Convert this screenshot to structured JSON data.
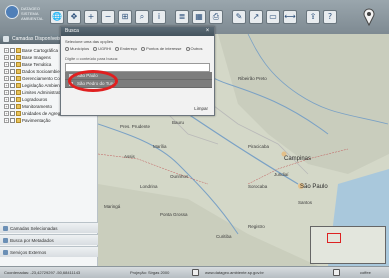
{
  "header": {
    "logo_text": "DATAGEO SISTEMA AMBIENTAL",
    "toolbar": [
      {
        "icon": "globe-icon",
        "glyph": "🌐"
      },
      {
        "icon": "pan-icon",
        "glyph": "✥"
      },
      {
        "icon": "zoom-in-icon",
        "glyph": "+"
      },
      {
        "icon": "zoom-out-icon",
        "glyph": "−"
      },
      {
        "icon": "zoom-box-icon",
        "glyph": "⊞"
      },
      {
        "icon": "search-icon",
        "glyph": "⌕"
      },
      {
        "icon": "info-icon",
        "glyph": "i"
      },
      {
        "icon": "layers-icon",
        "glyph": "≣"
      },
      {
        "icon": "table-icon",
        "glyph": "▦"
      },
      {
        "icon": "print-icon",
        "glyph": "⎙"
      },
      {
        "icon": "draw-icon",
        "glyph": "✎"
      },
      {
        "icon": "arrow-icon",
        "glyph": "↗"
      },
      {
        "icon": "shape-icon",
        "glyph": "▭"
      },
      {
        "icon": "measure-icon",
        "glyph": "⟷"
      },
      {
        "icon": "export-icon",
        "glyph": "⇪"
      },
      {
        "icon": "help-icon",
        "glyph": "?"
      }
    ]
  },
  "sidebar": {
    "title": "Camadas Disponíveis",
    "items": [
      {
        "label": "Base Cartográfica"
      },
      {
        "label": "Base Imagens"
      },
      {
        "label": "Base Temática"
      },
      {
        "label": "Dados Socioambientais"
      },
      {
        "label": "Gerenciamento Costeiro"
      },
      {
        "label": "Legislação Ambiental"
      },
      {
        "label": "Limites Administrativos"
      },
      {
        "label": "Logradouros"
      },
      {
        "label": "Monitoramento"
      },
      {
        "label": "Unidades de Agregação e Análise"
      },
      {
        "label": "Pavimentação"
      }
    ],
    "accordion": [
      {
        "label": "Camadas Selecionadas"
      },
      {
        "label": "Busca por Metadados"
      },
      {
        "label": "Serviços Externos"
      }
    ]
  },
  "dialog": {
    "title": "Busca",
    "instruction": "Selecione uma das opções",
    "options": [
      {
        "label": "Municípios"
      },
      {
        "label": "UGRHI"
      },
      {
        "label": "Endereço"
      },
      {
        "label": "Pontos de interesse"
      },
      {
        "label": "Outros"
      }
    ],
    "search_label": "Digite o conteúdo para busca:",
    "search_value": "",
    "results": [
      {
        "label": "São Paulo"
      },
      {
        "label": "São Pedro do Turvo"
      }
    ],
    "footer": "Limpar"
  },
  "map": {
    "cities": [
      {
        "name": "Pres. Prudente",
        "big": false
      },
      {
        "name": "Marília",
        "big": false
      },
      {
        "name": "Bauru",
        "big": false
      },
      {
        "name": "Ourinhos",
        "big": false
      },
      {
        "name": "Assis",
        "big": false
      },
      {
        "name": "Londrina",
        "big": false
      },
      {
        "name": "Maringá",
        "big": false
      },
      {
        "name": "Campinas",
        "big": true
      },
      {
        "name": "São Paulo",
        "big": true
      },
      {
        "name": "Piracicaba",
        "big": false
      },
      {
        "name": "Sorocaba",
        "big": false
      },
      {
        "name": "Jundiaí",
        "big": false
      },
      {
        "name": "Ribeirão Preto",
        "big": false
      },
      {
        "name": "Ponta Grossa",
        "big": false
      },
      {
        "name": "Curitiba",
        "big": false
      },
      {
        "name": "Registro",
        "big": false
      },
      {
        "name": "Santos",
        "big": false
      }
    ]
  },
  "status": {
    "left": "Coordenadas: -23,42729297 -50,68411143",
    "middle": "Projeção: Sirgas 2000",
    "right": "www.datageo.ambiente.sp.gov.br",
    "brand": "coffee"
  }
}
